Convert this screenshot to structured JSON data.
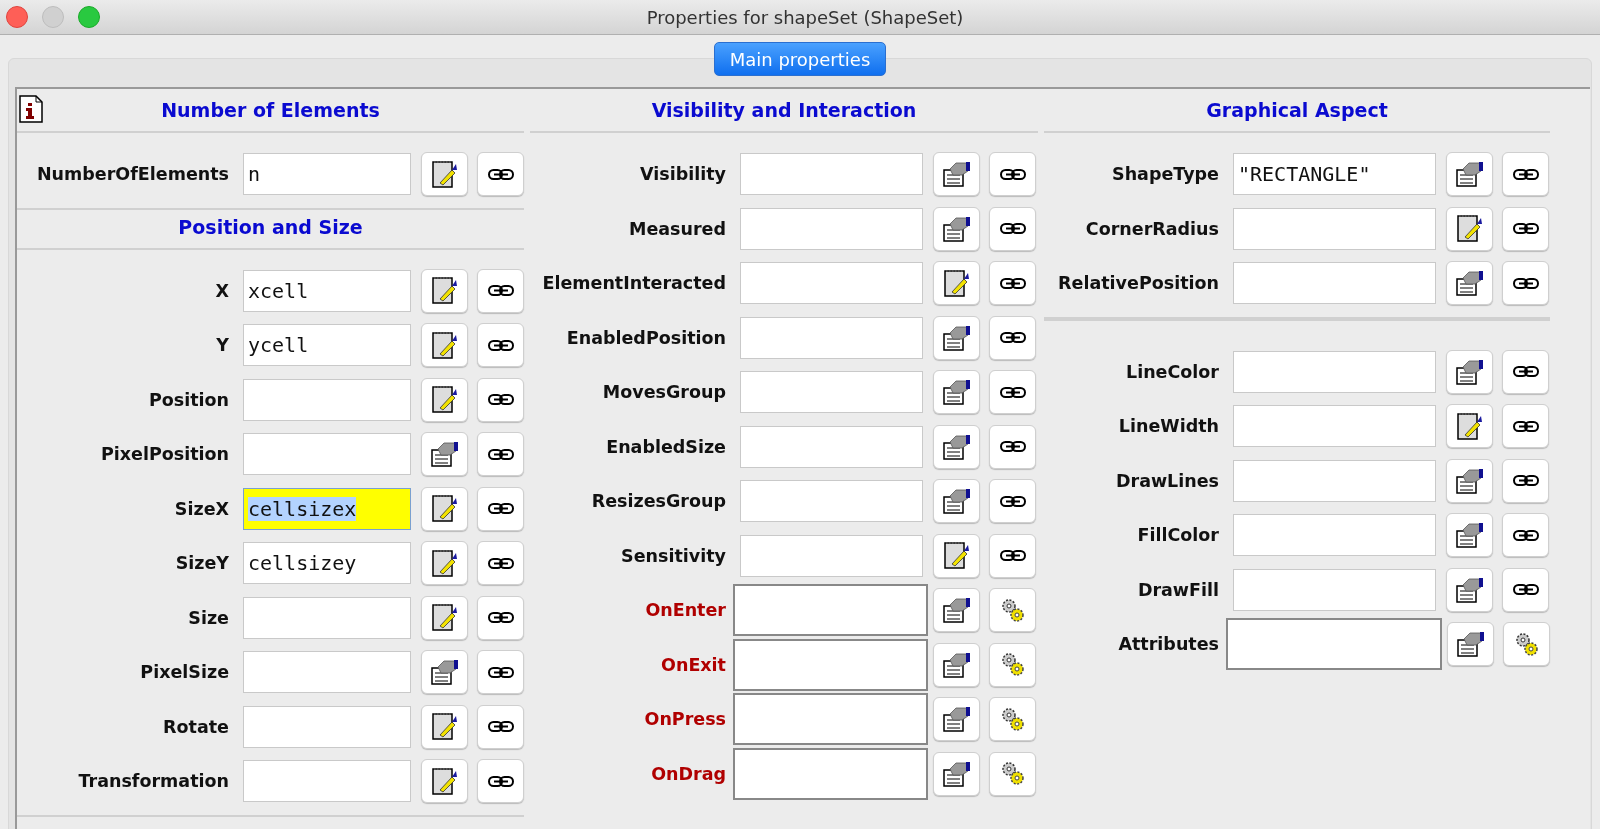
{
  "window": {
    "title": "Properties for shapeSet (ShapeSet)"
  },
  "tabs": [
    {
      "label": "Main properties",
      "selected": true
    }
  ],
  "columns": [
    {
      "sections": [
        {
          "title": "Number of Elements",
          "rows": [
            {
              "label": "NumberOfElements",
              "value": "n",
              "kind": "property",
              "editor_button": {
                "kind": "notepad"
              },
              "selected": false
            }
          ]
        },
        {
          "title": "Position and Size",
          "rows": [
            {
              "label": "X",
              "value": "xcell",
              "kind": "property",
              "editor_button": {
                "kind": "notepad"
              },
              "selected": false
            },
            {
              "label": "Y",
              "value": "ycell",
              "kind": "property",
              "editor_button": {
                "kind": "notepad"
              },
              "selected": false
            },
            {
              "label": "Position",
              "kind": "property",
              "editor_button": {
                "kind": "notepad"
              },
              "selected": false
            },
            {
              "label": "PixelPosition",
              "kind": "property",
              "editor_button": {
                "kind": "form"
              },
              "selected": false
            },
            {
              "label": "SizeX",
              "value": "cellsizex",
              "kind": "property",
              "editor_button": {
                "kind": "notepad"
              },
              "selected": true
            },
            {
              "label": "SizeY",
              "value": "cellsizey",
              "kind": "property",
              "editor_button": {
                "kind": "notepad"
              },
              "selected": false
            },
            {
              "label": "Size",
              "kind": "property",
              "editor_button": {
                "kind": "notepad"
              },
              "selected": false
            },
            {
              "label": "PixelSize",
              "kind": "property",
              "editor_button": {
                "kind": "form"
              },
              "selected": false
            },
            {
              "label": "Rotate",
              "kind": "property",
              "editor_button": {
                "kind": "notepad"
              },
              "selected": false
            },
            {
              "label": "Transformation",
              "kind": "property",
              "editor_button": {
                "kind": "notepad"
              },
              "selected": false
            }
          ]
        }
      ]
    },
    {
      "sections": [
        {
          "title": "Visibility and Interaction",
          "rows": [
            {
              "label": "Visibility",
              "kind": "property",
              "editor_button": {
                "kind": "form"
              },
              "selected": false
            },
            {
              "label": "Measured",
              "kind": "property",
              "editor_button": {
                "kind": "form"
              },
              "selected": false
            },
            {
              "label": "ElementInteracted",
              "kind": "property",
              "editor_button": {
                "kind": "notepad"
              },
              "selected": false
            },
            {
              "label": "EnabledPosition",
              "kind": "property",
              "editor_button": {
                "kind": "form"
              },
              "selected": false
            },
            {
              "label": "MovesGroup",
              "kind": "property",
              "editor_button": {
                "kind": "form"
              },
              "selected": false
            },
            {
              "label": "EnabledSize",
              "kind": "property",
              "editor_button": {
                "kind": "form"
              },
              "selected": false
            },
            {
              "label": "ResizesGroup",
              "kind": "property",
              "editor_button": {
                "kind": "form"
              },
              "selected": false
            },
            {
              "label": "Sensitivity",
              "kind": "property",
              "editor_button": {
                "kind": "notepad"
              },
              "selected": false
            },
            {
              "label": "OnEnter",
              "kind": "event",
              "editor_button": {
                "kind": "form"
              },
              "selected": false
            },
            {
              "label": "OnExit",
              "kind": "event",
              "editor_button": {
                "kind": "form"
              },
              "selected": false
            },
            {
              "label": "OnPress",
              "kind": "event",
              "editor_button": {
                "kind": "form"
              },
              "selected": false
            },
            {
              "label": "OnDrag",
              "kind": "event",
              "editor_button": {
                "kind": "form"
              },
              "selected": false
            }
          ]
        }
      ]
    },
    {
      "sections": [
        {
          "title": "Graphical Aspect",
          "rows": [
            {
              "label": "ShapeType",
              "value": "\"RECTANGLE\"",
              "kind": "property",
              "editor_button": {
                "kind": "form"
              },
              "selected": false
            },
            {
              "label": "CornerRadius",
              "kind": "property",
              "editor_button": {
                "kind": "notepad"
              },
              "selected": false
            },
            {
              "label": "RelativePosition",
              "kind": "property",
              "editor_button": {
                "kind": "form"
              },
              "selected": false
            }
          ]
        },
        {
          "rows": [
            {
              "label": "LineColor",
              "kind": "property",
              "editor_button": {
                "kind": "form"
              },
              "selected": false
            },
            {
              "label": "LineWidth",
              "kind": "property",
              "editor_button": {
                "kind": "notepad"
              },
              "selected": false
            },
            {
              "label": "DrawLines",
              "kind": "property",
              "editor_button": {
                "kind": "form"
              },
              "selected": false
            },
            {
              "label": "FillColor",
              "kind": "property",
              "editor_button": {
                "kind": "form"
              },
              "selected": false
            },
            {
              "label": "DrawFill",
              "kind": "property",
              "editor_button": {
                "kind": "form"
              },
              "selected": false
            },
            {
              "label": "Attributes",
              "kind": "code",
              "editor_button": {
                "kind": "form"
              },
              "selected": false
            }
          ]
        }
      ]
    }
  ]
}
